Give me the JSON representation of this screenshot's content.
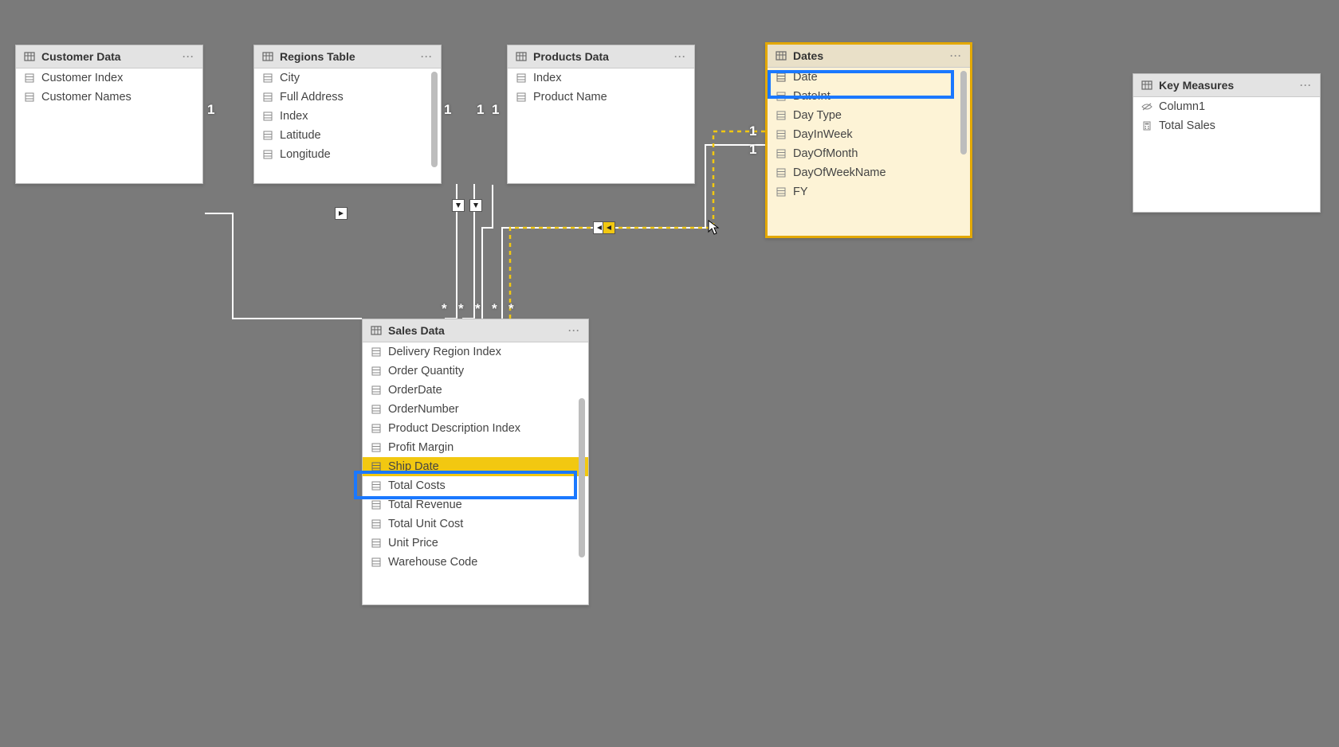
{
  "tables": {
    "customer": {
      "title": "Customer Data",
      "fields": [
        "Customer Index",
        "Customer Names"
      ]
    },
    "regions": {
      "title": "Regions Table",
      "fields": [
        "City",
        "Full Address",
        "Index",
        "Latitude",
        "Longitude"
      ]
    },
    "products": {
      "title": "Products Data",
      "fields": [
        "Index",
        "Product Name"
      ]
    },
    "dates": {
      "title": "Dates",
      "fields": [
        "Date",
        "DateInt",
        "Day Type",
        "DayInWeek",
        "DayOfMonth",
        "DayOfWeekName",
        "FY"
      ]
    },
    "measures": {
      "title": "Key Measures",
      "fields": [
        "Column1",
        "Total Sales"
      ]
    },
    "sales": {
      "title": "Sales Data",
      "fields": [
        "Delivery Region Index",
        "Order Quantity",
        "OrderDate",
        "OrderNumber",
        "Product Description Index",
        "Profit Margin",
        "Ship Date",
        "Total Costs",
        "Total Revenue",
        "Total Unit Cost",
        "Unit Price",
        "Warehouse Code"
      ]
    }
  },
  "relationship_labels": {
    "one": "1",
    "many": "*"
  },
  "highlighted_fields": {
    "dates_field": "Date",
    "sales_field": "Ship Date"
  }
}
